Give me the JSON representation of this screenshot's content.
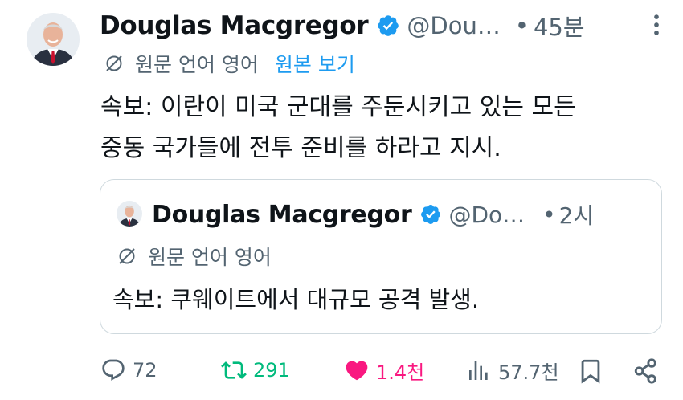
{
  "tweet": {
    "author_name": "Douglas Macgregor",
    "handle": "@Dou…",
    "separator": "•",
    "time": "45분",
    "translation_note": "원문 언어 영어",
    "show_original_label": "원본 보기",
    "body": "속보: 이란이 미국 군대를 주둔시키고 있는 모든\n중동 국가들에 전투 준비를 하라고 지시."
  },
  "quote": {
    "author_name": "Douglas Macgregor",
    "handle": "@Do…",
    "separator": "•",
    "time": "2시",
    "translation_note": "원문 언어 영어",
    "body": "속보: 쿠웨이트에서 대규모 공격 발생."
  },
  "actions": {
    "reply_count": "72",
    "retweet_count": "291",
    "like_count": "1.4천",
    "view_count": "57.7천"
  },
  "icons": {
    "verified": "verified-badge-icon",
    "more": "more-dots-icon",
    "translate": "globe-off-icon",
    "reply": "reply-icon",
    "retweet": "retweet-icon",
    "like": "heart-icon",
    "views": "views-bar-icon",
    "bookmark": "bookmark-icon",
    "share": "share-icon"
  },
  "colors": {
    "verified_blue": "#1d9bf0",
    "link_blue": "#1d9bf0",
    "retweet_green": "#00ba7c",
    "like_pink": "#f91880",
    "muted_gray": "#536471",
    "border": "#cfd9de"
  }
}
